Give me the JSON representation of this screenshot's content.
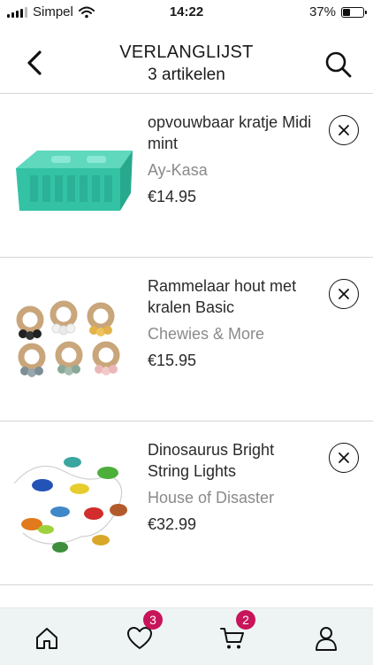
{
  "status_bar": {
    "carrier": "Simpel",
    "time": "14:22",
    "battery_text": "37%",
    "battery_level": 0.37
  },
  "header": {
    "title": "VERLANGLIJST",
    "subtitle": "3 artikelen"
  },
  "items": [
    {
      "name": "opvouwbaar kratje Midi mint",
      "brand": "Ay-Kasa",
      "price": "€14.95"
    },
    {
      "name": "Rammelaar hout met kralen Basic",
      "brand": "Chewies & More",
      "price": "€15.95"
    },
    {
      "name": "Dinosaurus Bright String Lights",
      "brand": "House of Disaster",
      "price": "€32.99"
    }
  ],
  "tabbar": {
    "wishlist_badge": "3",
    "cart_badge": "2",
    "accent_color": "#c8145a"
  },
  "icons": [
    "back-icon",
    "search-icon",
    "close-icon",
    "home-icon",
    "heart-icon",
    "cart-icon",
    "user-icon",
    "wifi-icon",
    "battery-icon"
  ]
}
